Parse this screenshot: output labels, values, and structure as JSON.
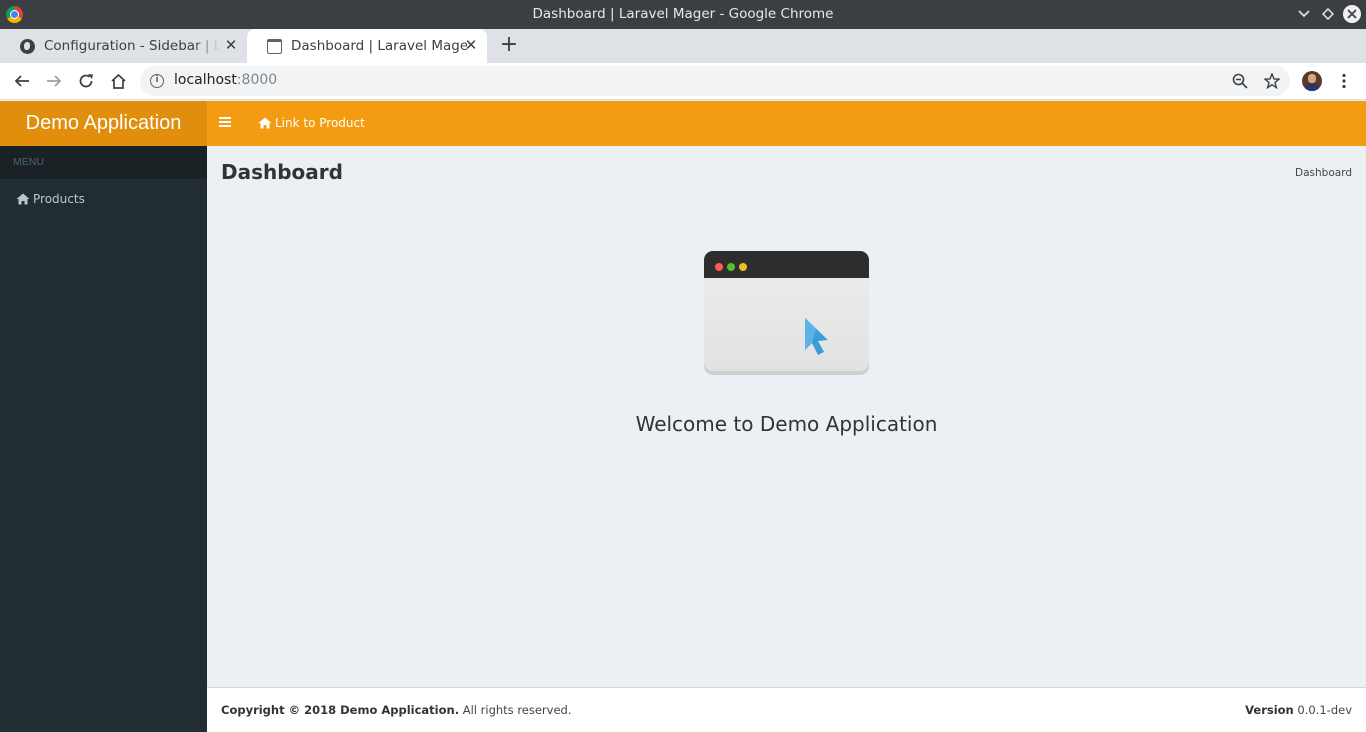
{
  "window": {
    "title": "Dashboard | Laravel Mager - Google Chrome"
  },
  "tabs": [
    {
      "title": "Configuration - Sidebar | Laravel Mager",
      "close": "✕",
      "active": false
    },
    {
      "title": "Dashboard | Laravel Mager",
      "close": "✕",
      "active": true
    }
  ],
  "new_tab": "+",
  "omnibox": {
    "host": "localhost",
    "port": ":8000"
  },
  "app": {
    "logo": "Demo Application",
    "navbar": {
      "link_label": "Link to Product"
    },
    "sidebar": {
      "header": "MENU",
      "items": [
        {
          "label": "Products",
          "icon": "home-icon"
        }
      ]
    },
    "content": {
      "title": "Dashboard",
      "breadcrumb": "Dashboard",
      "welcome": "Welcome to Demo Application"
    },
    "footer": {
      "copyright_bold": "Copyright © 2018 Demo Application.",
      "copyright_rest": " All rights reserved.",
      "version_label": "Version",
      "version_value": " 0.0.1-dev"
    }
  },
  "colors": {
    "accent": "#f39c12",
    "accent_dark": "#e08e0b",
    "sidebar": "#222d32",
    "content_bg": "#ecf0f5"
  }
}
